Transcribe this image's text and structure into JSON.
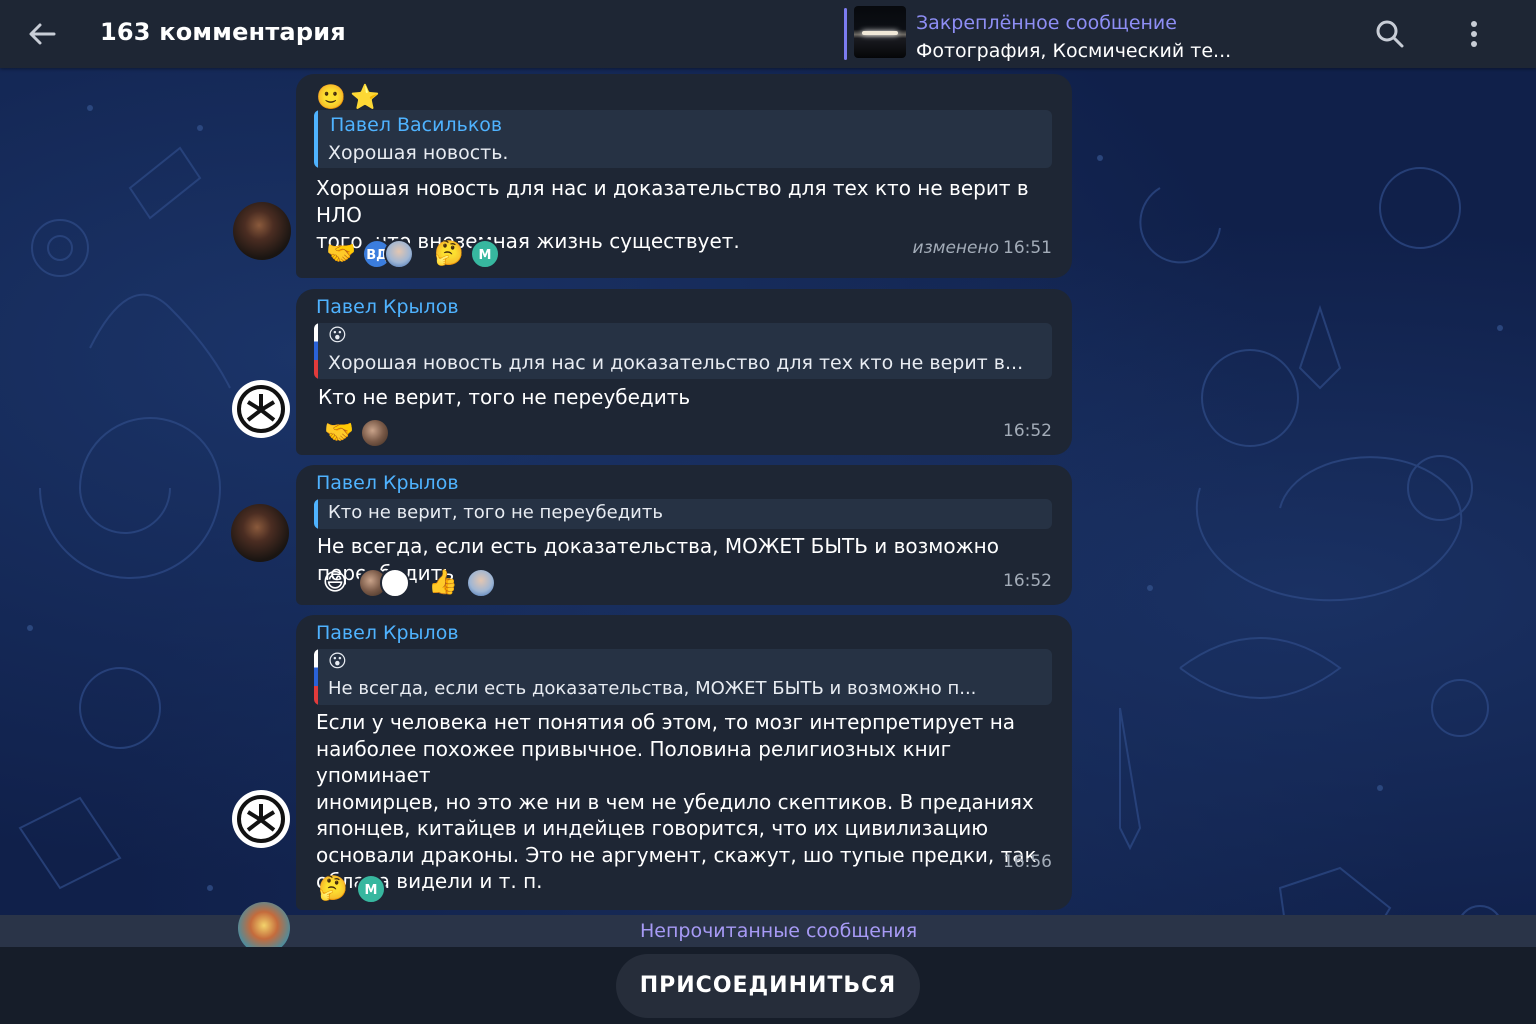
{
  "header": {
    "title": "163 комментария",
    "pinned_label": "Закреплённое сообщение",
    "pinned_text": "Фотография, Космический те..."
  },
  "messages": [
    {
      "top_reactions": [
        "🙂",
        "⭐"
      ],
      "quote_sender": "Павел Васильков",
      "quote_text": "Хорошая новость.",
      "text": "Хорошая новость для нас и доказательство для тех кто не верит в НЛО\nтого, что внеземная жизнь существует.",
      "edited_label": "изменено",
      "time": "16:51",
      "reactions": [
        "🤝",
        "ВД",
        "🤔",
        "М"
      ]
    },
    {
      "sender": "Павел Крылов",
      "quote_emoji": "😮",
      "quote_text": "Хорошая новость для нас и доказательство для тех кто не верит в...",
      "text": "Кто не верит, того не переубедить",
      "time": "16:52",
      "reactions": [
        "🤝"
      ]
    },
    {
      "sender": "Павел Крылов",
      "quote_text": "Кто не верит, того не переубедить",
      "text": "Не всегда, если есть доказательства, МОЖЕТ БЫТЬ и возможно переубедить",
      "time": "16:52",
      "reactions": [
        "😄",
        "👍"
      ]
    },
    {
      "sender": "Павел Крылов",
      "quote_emoji": "😮",
      "quote_text": "Не всегда, если есть доказательства, МОЖЕТ БЫТЬ и возможно п...",
      "text": "Если у человека нет понятия об этом, то мозг интерпретирует на\nнаиболее похожее привычное. Половина религиозных книг упоминает\nиномирцев, но это же ни в чем не убедило скептиков. В преданиях\nяпонцев, китайцев и индейцев говорится, что их цивилизацию\nосновали драконы. Это не аргумент, скажут, шо тупые предки, так\nоблака видели и т. п.",
      "time": "16:56",
      "reactions": [
        "🤔",
        "М"
      ]
    }
  ],
  "unread_label": "Непрочитанные сообщения",
  "join_button": "ПРИСОЕДИНИТЬСЯ",
  "colors": {
    "accent": "#4fb3ff",
    "pinned_accent": "#8e8ef5",
    "bubble": "#1e2634",
    "unread": "#a79af5"
  }
}
